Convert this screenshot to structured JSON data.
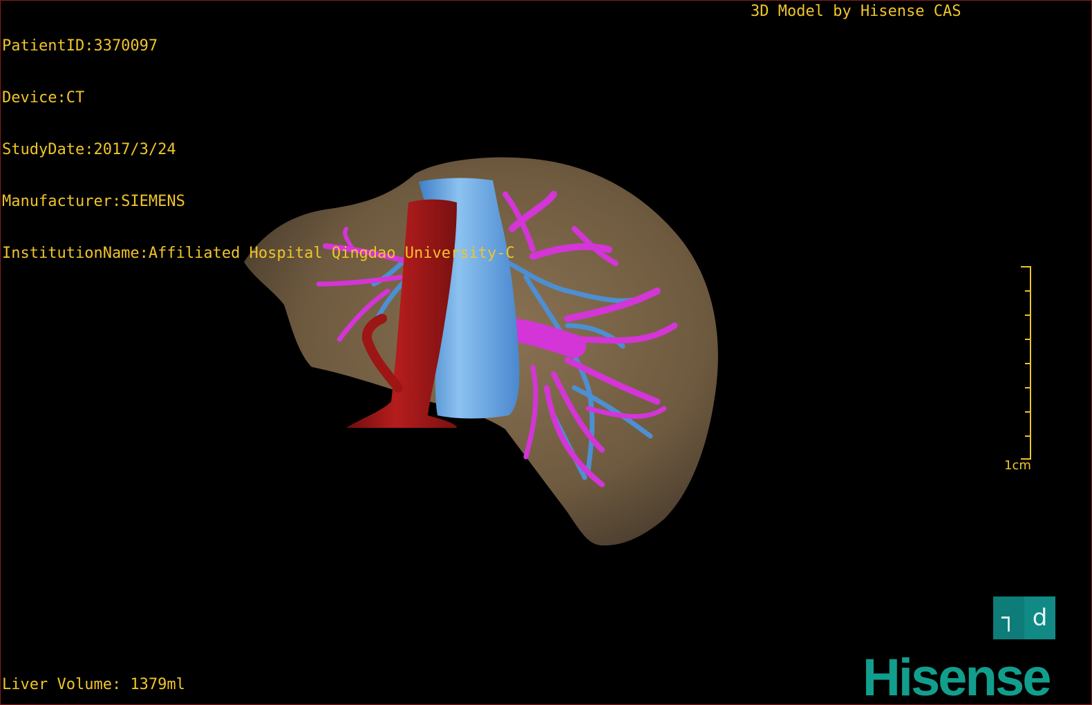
{
  "patient_info": {
    "patient_id": "PatientID:3370097",
    "device": "Device:CT",
    "study_date": "StudyDate:2017/3/24",
    "manufacturer": "Manufacturer:SIEMENS",
    "institution": "InstitutionName:Affiliated Hospital Qingdao University-C"
  },
  "credit": "3D Model by Hisense CAS",
  "liver_volume": "Liver Volume: 1379ml",
  "scale_bar": {
    "label": "1cm"
  },
  "orientation_cube": {
    "left_glyph": "┐",
    "right_glyph": "d"
  },
  "brand": "Hisense",
  "colors": {
    "overlay_text": "#f0c52a",
    "liver": "#7a6548",
    "artery": "#9e1515",
    "vena_cava": "#5e9fe0",
    "portal_vein": "#d335d6",
    "hepatic_vein": "#4d8fd1",
    "brand": "#129e8d"
  }
}
